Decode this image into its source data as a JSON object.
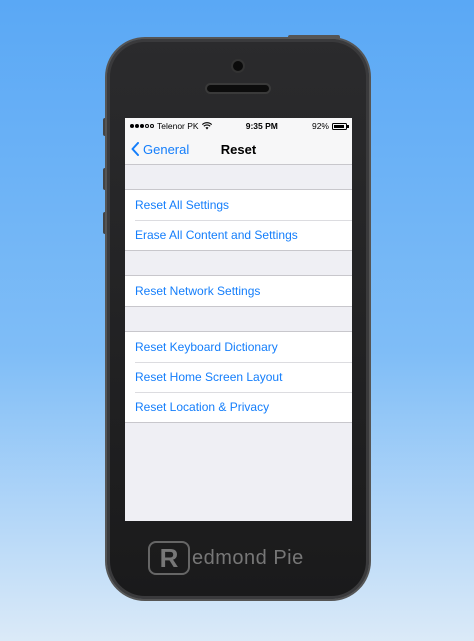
{
  "status_bar": {
    "carrier": "Telenor PK",
    "time": "9:35 PM",
    "battery": "92%",
    "battery_level": 0.92
  },
  "nav": {
    "back_label": "General",
    "title": "Reset"
  },
  "groups": [
    {
      "items": [
        "Reset All Settings",
        "Erase All Content and Settings"
      ]
    },
    {
      "items": [
        "Reset Network Settings"
      ]
    },
    {
      "items": [
        "Reset Keyboard Dictionary",
        "Reset Home Screen Layout",
        "Reset Location & Privacy"
      ]
    }
  ],
  "watermark": {
    "mark": "R",
    "text": "edmond Pie"
  },
  "colors": {
    "accent": "#147efb",
    "background": "#efeff4"
  }
}
